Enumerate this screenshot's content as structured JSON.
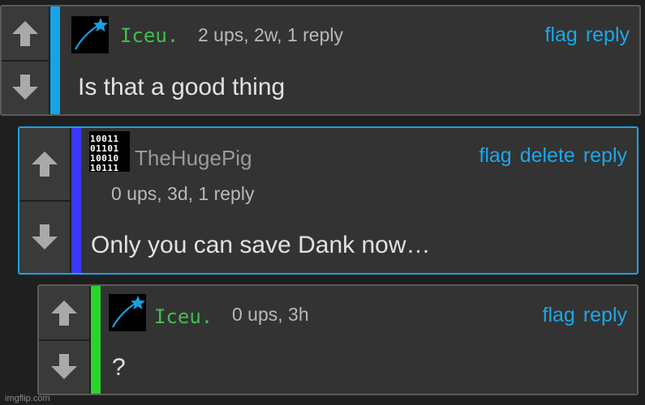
{
  "comments": [
    {
      "username": "Iceu.",
      "meta": "2 ups, 2w, 1 reply",
      "actions": [
        "flag",
        "reply"
      ],
      "text": "Is that a good thing",
      "stripe_color": "#17a3e6"
    },
    {
      "username": "TheHugePig",
      "meta": "0 ups, 3d, 1 reply",
      "actions": [
        "flag",
        "delete",
        "reply"
      ],
      "text": "Only you can save Dank now…",
      "stripe_color": "#3a3aff"
    },
    {
      "username": "Iceu.",
      "meta": "0 ups, 3h",
      "actions": [
        "flag",
        "reply"
      ],
      "text": "?",
      "stripe_color": "#2ad52a"
    }
  ],
  "binary_avatar_text": [
    "10011",
    "01101",
    "10010",
    "10111"
  ],
  "watermark": "imgflip.com",
  "colors": {
    "accent": "#1aa8e8",
    "background": "#1f1f1f",
    "card": "#333333"
  }
}
